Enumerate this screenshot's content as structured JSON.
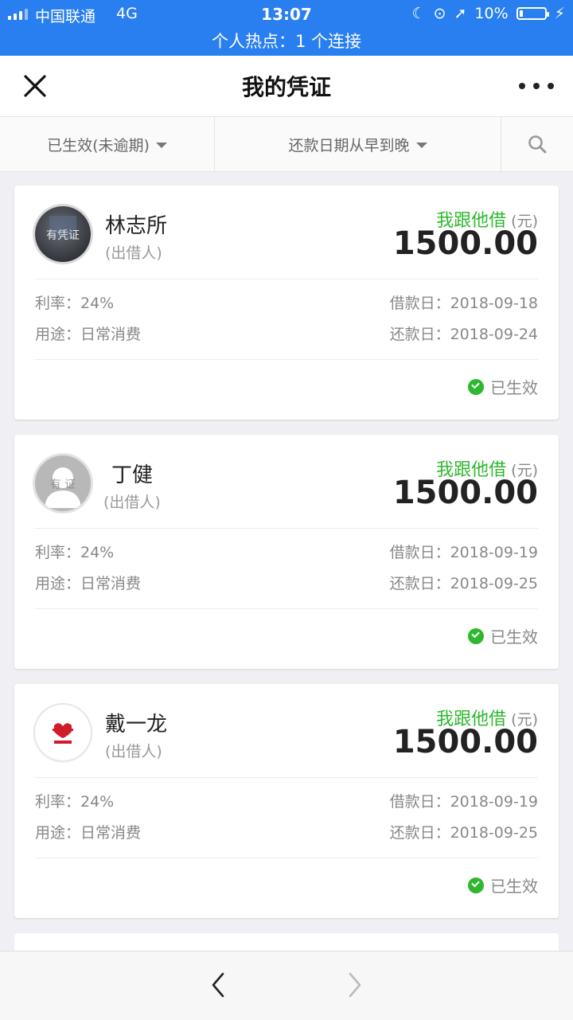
{
  "status_bar": {
    "carrier": "中国联通",
    "network": "4G",
    "time": "13:07",
    "battery": "10%",
    "hotspot": "个人热点：1 个连接"
  },
  "nav": {
    "title": "我的凭证",
    "close_icon": "close-icon",
    "more_icon": "more-icon"
  },
  "filters": {
    "status": "已生效(未逾期)",
    "sort": "还款日期从早到晚",
    "search_icon": "search-icon"
  },
  "cards": [
    {
      "name": "林志所",
      "role": "(出借人)",
      "avatar_overlay": "有凭证",
      "loan_type": "我跟他借",
      "unit": "(元)",
      "amount": "1500.00",
      "rate": "利率：24%",
      "purpose": "用途：日常消费",
      "borrow_date": "借款日：2018-09-18",
      "repay_date": "还款日：2018-09-24",
      "status": "已生效"
    },
    {
      "name": "丁健",
      "role": "(出借人)",
      "avatar_overlay": "有  证",
      "loan_type": "我跟他借",
      "unit": "(元)",
      "amount": "1500.00",
      "rate": "利率：24%",
      "purpose": "用途：日常消费",
      "borrow_date": "借款日：2018-09-19",
      "repay_date": "还款日：2018-09-25",
      "status": "已生效"
    },
    {
      "name": "戴一龙",
      "role": "(出借人)",
      "avatar_overlay": "",
      "loan_type": "我跟他借",
      "unit": "(元)",
      "amount": "1500.00",
      "rate": "利率：24%",
      "purpose": "用途：日常消费",
      "borrow_date": "借款日：2018-09-19",
      "repay_date": "还款日：2018-09-25",
      "status": "已生效"
    }
  ],
  "bottom": {
    "back_icon": "chevron-left-icon",
    "forward_icon": "chevron-right-icon"
  },
  "colors": {
    "status_bar": "#2a7ff0",
    "accent_green": "#2eb82e",
    "text_primary": "#222222",
    "text_secondary": "#888888"
  }
}
